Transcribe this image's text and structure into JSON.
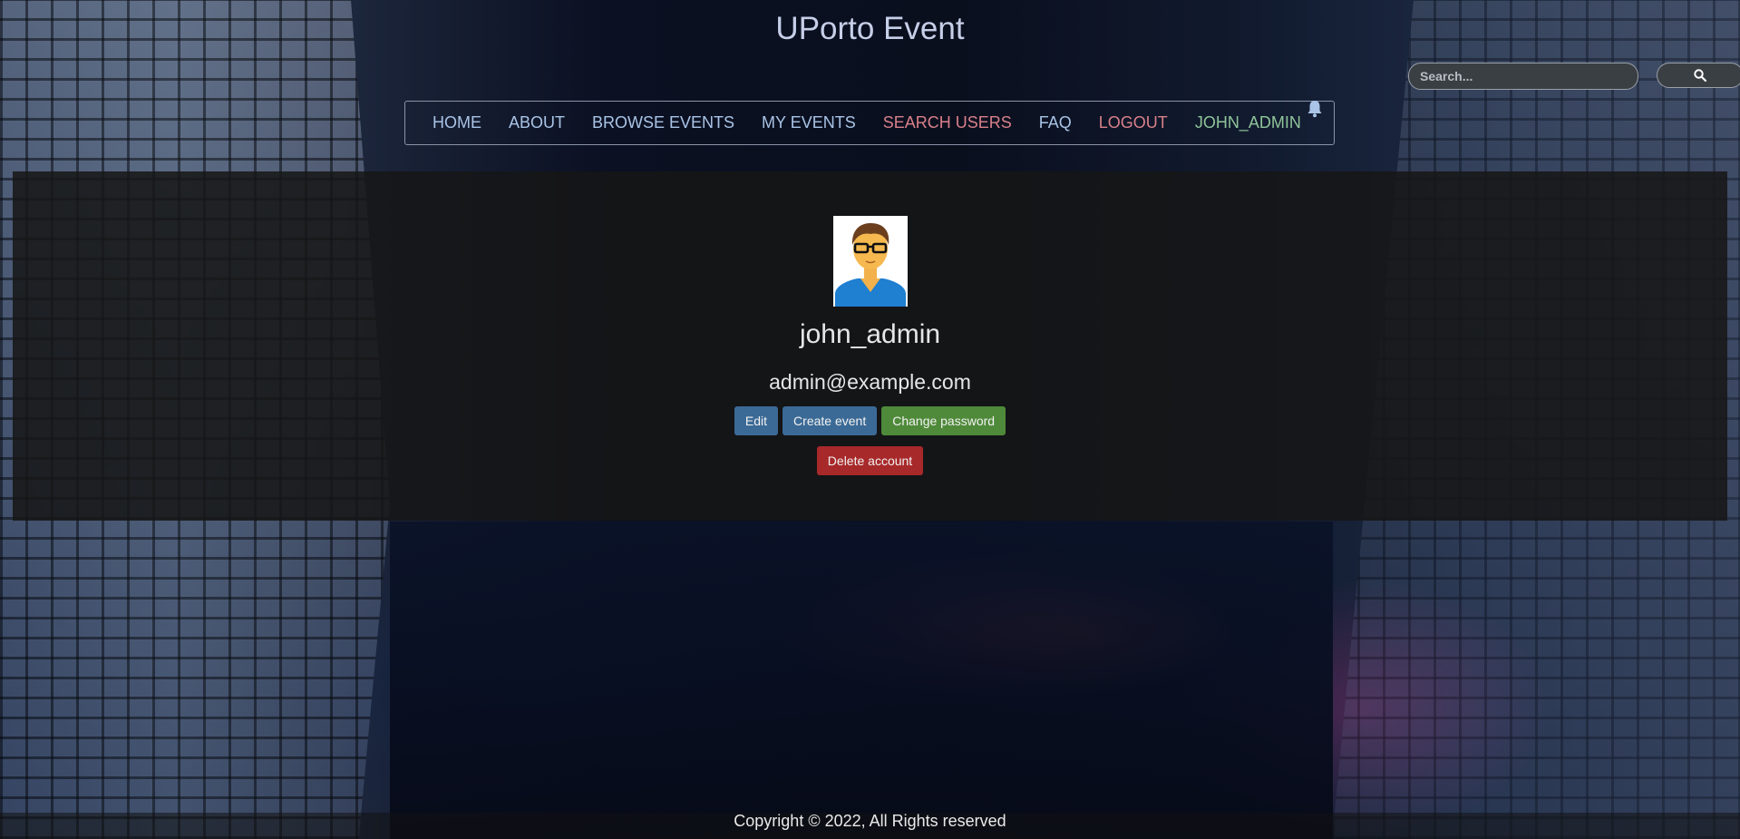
{
  "site": {
    "title": "UPorto Event"
  },
  "search": {
    "placeholder": "Search..."
  },
  "nav": {
    "home": "HOME",
    "about": "ABOUT",
    "browse_events": "BROWSE EVENTS",
    "my_events": "MY EVENTS",
    "search_users": "SEARCH USERS",
    "faq": "FAQ",
    "logout": "LOGOUT",
    "user": "JOHN_ADMIN"
  },
  "profile": {
    "username": "john_admin",
    "email": "admin@example.com",
    "buttons": {
      "edit": "Edit",
      "create_event": "Create event",
      "change_password": "Change password",
      "delete_account": "Delete account"
    }
  },
  "footer": {
    "copyright": "Copyright © 2022, All Rights reserved"
  },
  "colors": {
    "edit_button": "#3b6a96",
    "create_event_button": "#3b6a96",
    "change_password_button": "#4f8a3a",
    "delete_button": "#a8292a",
    "nav_link": "#a9c4e6",
    "nav_alert_link": "#d9808a",
    "nav_user_link": "#8fc49a"
  },
  "icons": {
    "search": "search-icon",
    "notifications": "bell-icon",
    "avatar": "user-avatar"
  }
}
